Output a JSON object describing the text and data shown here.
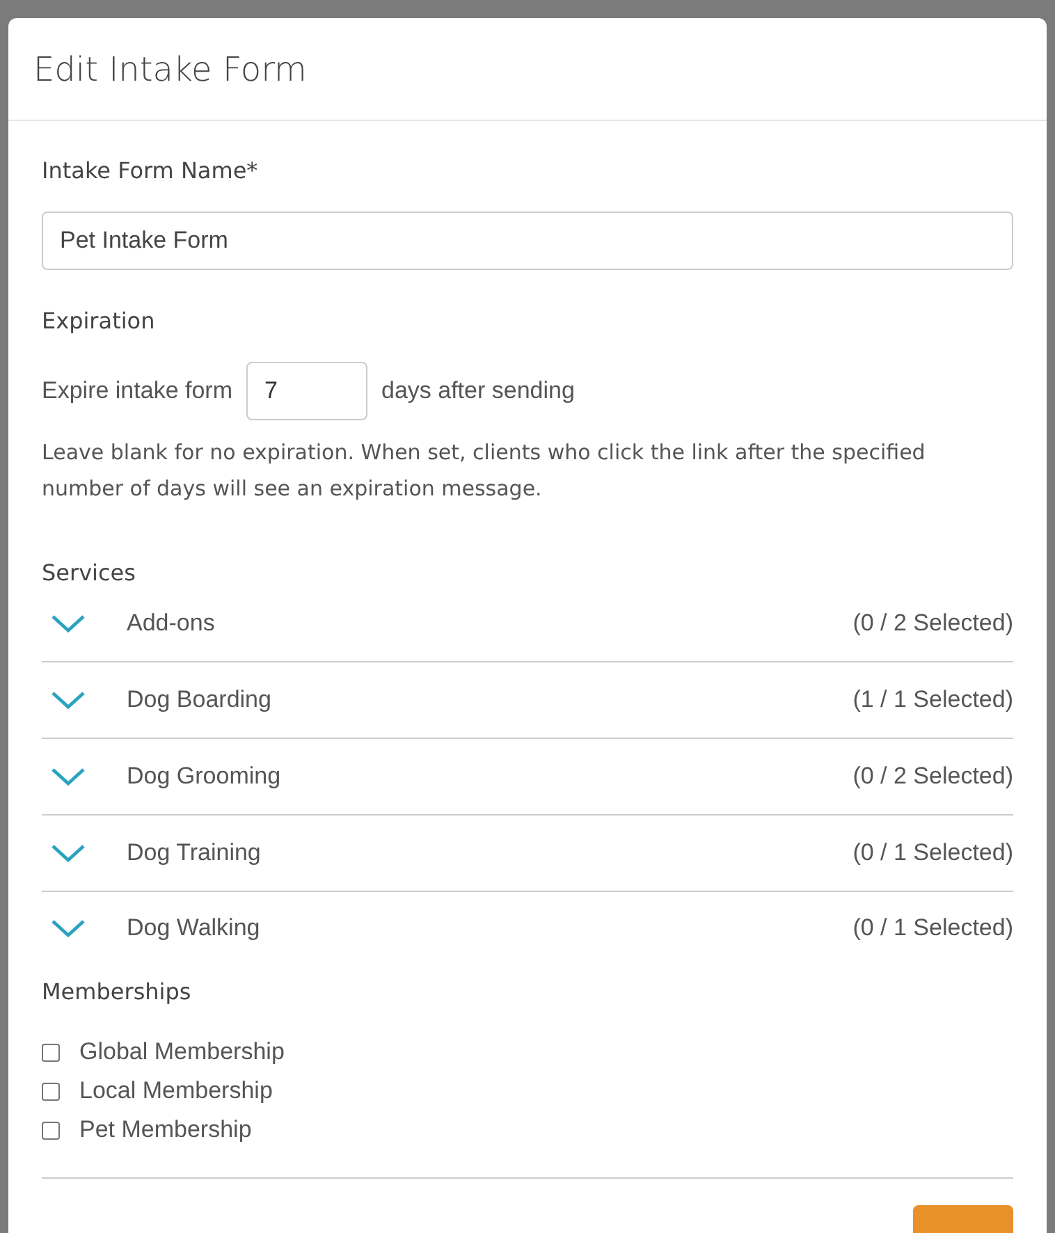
{
  "dialog": {
    "title": "Edit Intake Form"
  },
  "name_field": {
    "label": "Intake Form Name*",
    "value": "Pet Intake Form"
  },
  "expiration": {
    "heading": "Expiration",
    "prefix": "Expire intake form",
    "value": "7",
    "suffix": "days after sending",
    "help": "Leave blank for no expiration. When set, clients who click the link after the specified number of days will see an expiration message."
  },
  "services": {
    "heading": "Services",
    "items": [
      {
        "name": "Add-ons",
        "count": "(0 / 2 Selected)",
        "expanded": false
      },
      {
        "name": "Dog Boarding",
        "count": "(1 / 1 Selected)",
        "expanded": false
      },
      {
        "name": "Dog Grooming",
        "count": "(0 / 2 Selected)",
        "expanded": false
      },
      {
        "name": "Dog Training",
        "count": "(0 / 1 Selected)",
        "expanded": false
      },
      {
        "name": "Dog Walking",
        "count": "(0 / 1 Selected)",
        "expanded": false
      }
    ]
  },
  "memberships": {
    "heading": "Memberships",
    "items": [
      {
        "label": "Global Membership",
        "checked": false
      },
      {
        "label": "Local Membership",
        "checked": false
      },
      {
        "label": "Pet Membership",
        "checked": false
      }
    ]
  }
}
